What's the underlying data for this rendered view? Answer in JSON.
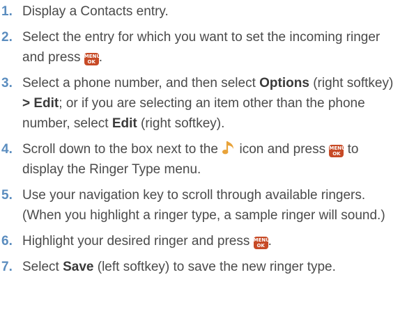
{
  "steps": [
    {
      "num": "1.",
      "text": "Display a Contacts entry."
    },
    {
      "num": "2.",
      "text_a": "Select the entry for which you want to set the incoming ringer and press ",
      "text_b": "."
    },
    {
      "num": "3.",
      "text_a": "Select a phone number, and then select ",
      "bold_a": "Options",
      "text_b": " (right softkey) ",
      "bold_b": "> Edit",
      "text_c": "; or if you are selecting an item other than the phone number, select ",
      "bold_c": "Edit",
      "text_d": " (right softkey)."
    },
    {
      "num": "4.",
      "text_a": "Scroll down to the box next to the ",
      "text_b": " icon and press ",
      "text_c": " to display the Ringer Type menu."
    },
    {
      "num": "5.",
      "text": "Use your navigation key to scroll through available ringers. (When you highlight a ringer type, a sample ringer will sound.)"
    },
    {
      "num": "6.",
      "text_a": "Highlight your desired ringer and press ",
      "text_b": "."
    },
    {
      "num": "7.",
      "text_a": "Select ",
      "bold_a": "Save",
      "text_b": " (left softkey) to save the new ringer type."
    }
  ],
  "menu_key": {
    "top": "MENU",
    "bottom": "OK"
  },
  "colors": {
    "step_number": "#5b8dbf",
    "body_text": "#4a4a4a",
    "menu_key_bg": "#c74a26",
    "note_icon": "#e8a33a"
  },
  "icons": {
    "menu_key": "menu-ok-key-icon",
    "ringer": "music-note-icon"
  }
}
